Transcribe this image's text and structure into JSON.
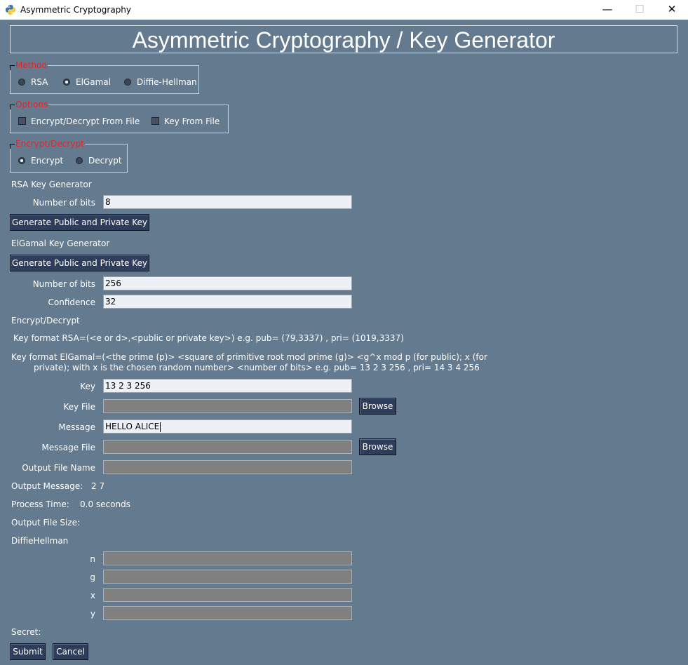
{
  "window": {
    "title": "Asymmetric Cryptography",
    "minimize": "—",
    "maximize": "☐",
    "close": "✕"
  },
  "header": {
    "title": "Asymmetric Cryptography / Key Generator"
  },
  "method": {
    "legend": "Method",
    "options": [
      "RSA",
      "ElGamal",
      "Diffie-Hellman"
    ],
    "selected": "ElGamal"
  },
  "options_group": {
    "legend": "Options",
    "items": [
      {
        "label": "Encrypt/Decrypt From File",
        "checked": false
      },
      {
        "label": "Key From File",
        "checked": false
      }
    ]
  },
  "mode": {
    "legend": "Encrypt/Decrypt",
    "options": [
      "Encrypt",
      "Decrypt"
    ],
    "selected": "Encrypt"
  },
  "rsa": {
    "heading": "RSA Key Generator",
    "bits_label": "Number of bits",
    "bits_value": "8",
    "generate_label": "Generate Public and Private Key"
  },
  "elgamal": {
    "heading": "ElGamal Key Generator",
    "generate_label": "Generate Public and Private Key",
    "bits_label": "Number of bits",
    "bits_value": "256",
    "confidence_label": "Confidence",
    "confidence_value": "32"
  },
  "encdec": {
    "heading": "Encrypt/Decrypt",
    "rsa_format": "Key format RSA=(<e or d>,<public or private key>) e.g. pub= (79,3337) , pri= (1019,3337)",
    "elgamal_format_line1": "Key format ElGamal=(<the prime (p)> <square of primitive root mod prime (g)> <g^x mod p (for public); x (for",
    "elgamal_format_line2": "private); with x is the chosen random number> <number of bits> e.g. pub= 13 2 3 256 , pri= 14 3 4 256",
    "key_label": "Key",
    "key_value": "13 2 3 256",
    "key_file_label": "Key File",
    "key_file_value": "",
    "browse_label": "Browse",
    "message_label": "Message",
    "message_value": "HELLO ALICE",
    "message_file_label": "Message File",
    "message_file_value": "",
    "output_file_name_label": "Output File Name",
    "output_file_name_value": "",
    "output_message_label": "Output Message:",
    "output_message_value": "2 7",
    "process_time_label": "Process Time:",
    "process_time_value": "0.0 seconds",
    "output_file_size_label": "Output File Size:",
    "output_file_size_value": ""
  },
  "dh": {
    "heading": "DiffieHellman",
    "n_label": "n",
    "n_value": "",
    "g_label": "g",
    "g_value": "",
    "x_label": "x",
    "x_value": "",
    "y_label": "y",
    "y_value": "",
    "secret_label": "Secret:",
    "secret_value": ""
  },
  "actions": {
    "submit_label": "Submit",
    "cancel_label": "Cancel"
  },
  "colors": {
    "background": "#647a8f",
    "legend": "#e8242a",
    "button": "#2e3d5c",
    "disabled_field": "#808080"
  }
}
